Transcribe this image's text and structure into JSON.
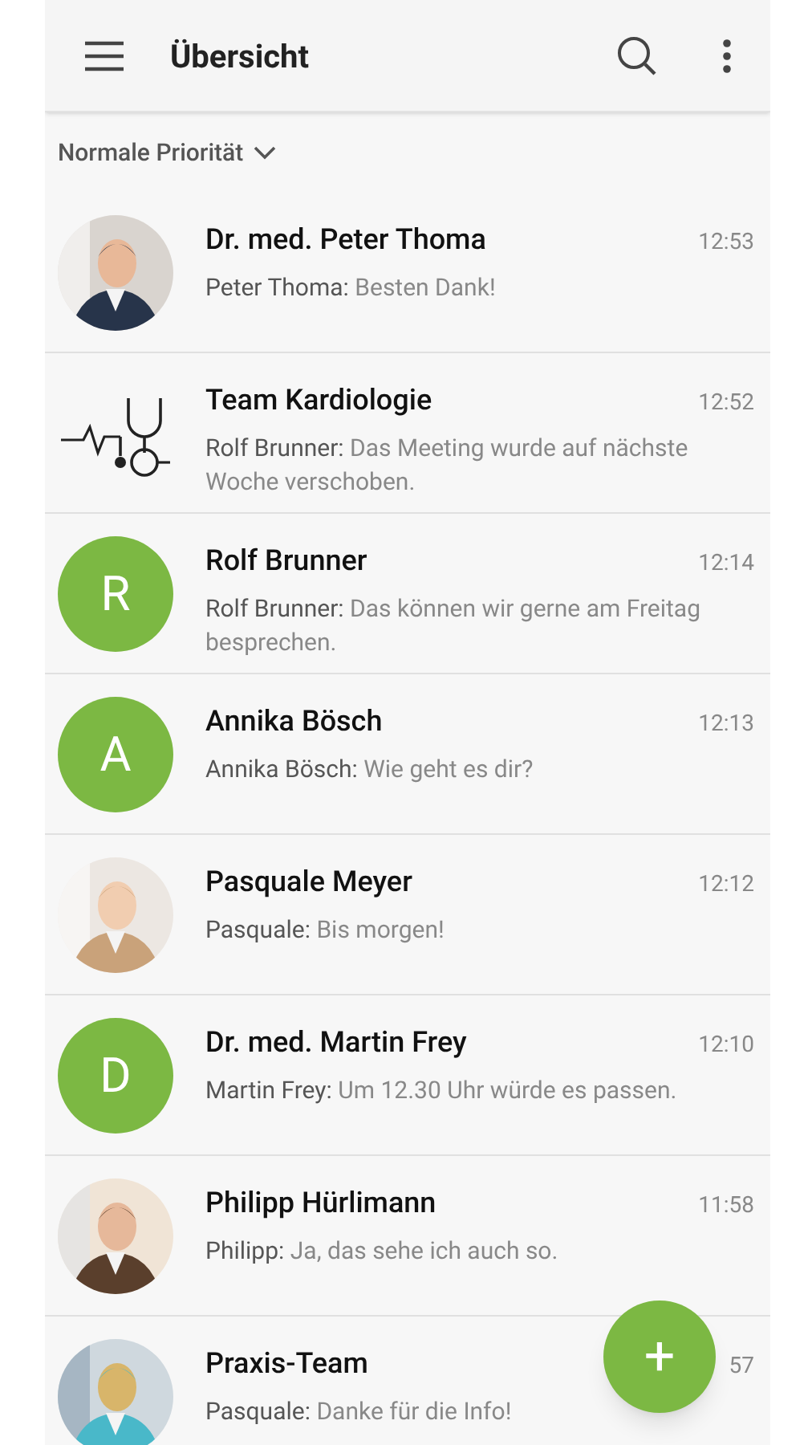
{
  "app_bar": {
    "title": "Übersicht"
  },
  "filter": {
    "label": "Normale Priorität"
  },
  "chats": [
    {
      "name": "Dr. med. Peter Thoma",
      "time": "12:53",
      "sender": "Peter Thoma:",
      "message": "Besten Dank!"
    },
    {
      "avatar": {
        "kind": "icon"
      },
      "name": "Team Kardiologie",
      "time": "12:52",
      "sender": "Rolf Brunner:",
      "message": "Das Meeting wurde auf nächste Woche verschoben."
    },
    {
      "avatar": {
        "kind": "letter",
        "letter": "R"
      },
      "name": "Rolf Brunner",
      "time": "12:14",
      "sender": "Rolf Brunner:",
      "message": "Das können wir gerne am Freitag besprechen."
    },
    {
      "avatar": {
        "kind": "letter",
        "letter": "A"
      },
      "name": "Annika Bösch",
      "time": "12:13",
      "sender": "Annika Bösch:",
      "message": "Wie geht es dir?"
    },
    {
      "name": "Pasquale Meyer",
      "time": "12:12",
      "sender": "Pasquale:",
      "message": "Bis morgen!"
    },
    {
      "avatar": {
        "kind": "letter",
        "letter": "D"
      },
      "name": "Dr. med. Martin Frey",
      "time": "12:10",
      "sender": "Martin Frey:",
      "message": "Um 12.30 Uhr würde es passen."
    },
    {
      "name": "Philipp Hürlimann",
      "time": "11:58",
      "sender": "Philipp:",
      "message": "Ja, das sehe ich auch so."
    },
    {
      "name": "Praxis-Team",
      "time": "57",
      "sender": "Pasquale:",
      "message": "Danke für die Info!"
    }
  ],
  "fab": {
    "label": "+"
  }
}
